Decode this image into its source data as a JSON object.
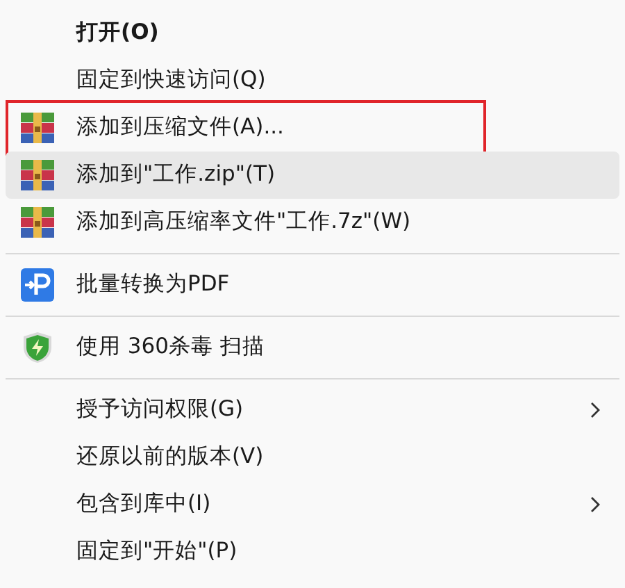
{
  "groups": [
    {
      "items": [
        {
          "label": "打开(O)",
          "bold": true,
          "kind": "plain",
          "submenu": false,
          "hovered": false,
          "annotated": false
        },
        {
          "label": "固定到快速访问(Q)",
          "bold": false,
          "kind": "plain",
          "submenu": false,
          "hovered": false,
          "annotated": false
        },
        {
          "label": "添加到压缩文件(A)...",
          "bold": false,
          "kind": "archive",
          "submenu": false,
          "hovered": false,
          "annotated": true
        },
        {
          "label": "添加到\"工作.zip\"(T)",
          "bold": false,
          "kind": "archive",
          "submenu": false,
          "hovered": true,
          "annotated": false
        },
        {
          "label": "添加到高压缩率文件\"工作.7z\"(W)",
          "bold": false,
          "kind": "archive",
          "submenu": false,
          "hovered": false,
          "annotated": false
        }
      ]
    },
    {
      "items": [
        {
          "label": "批量转换为PDF",
          "bold": false,
          "kind": "pdf",
          "submenu": false,
          "hovered": false,
          "annotated": false
        }
      ]
    },
    {
      "items": [
        {
          "label": "使用 360杀毒 扫描",
          "bold": false,
          "kind": "shield",
          "submenu": false,
          "hovered": false,
          "annotated": false
        }
      ]
    },
    {
      "items": [
        {
          "label": "授予访问权限(G)",
          "bold": false,
          "kind": "plain",
          "submenu": true,
          "hovered": false,
          "annotated": false
        },
        {
          "label": "还原以前的版本(V)",
          "bold": false,
          "kind": "plain",
          "submenu": false,
          "hovered": false,
          "annotated": false
        },
        {
          "label": "包含到库中(I)",
          "bold": false,
          "kind": "plain",
          "submenu": true,
          "hovered": false,
          "annotated": false
        },
        {
          "label": "固定到\"开始\"(P)",
          "bold": false,
          "kind": "plain",
          "submenu": false,
          "hovered": false,
          "annotated": false
        }
      ]
    }
  ]
}
